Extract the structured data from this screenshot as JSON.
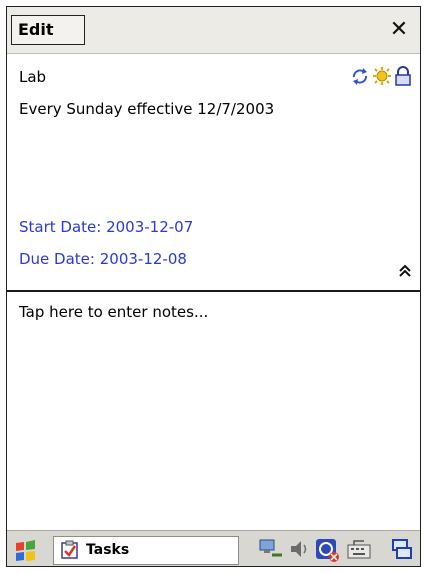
{
  "header": {
    "edit_label": "Edit",
    "close_label": "✕"
  },
  "task": {
    "name": "Lab",
    "recurrence": "Every Sunday effective 12/7/2003",
    "start_date": "Start Date: 2003-12-07",
    "due_date": "Due Date: 2003-12-08"
  },
  "notes": {
    "placeholder": "Tap here to enter notes..."
  },
  "taskbar": {
    "active_task": "Tasks"
  },
  "colors": {
    "link_blue": "#2b38d6",
    "titlebar": "#ecebe6",
    "taskbar": "#d8d7d1"
  },
  "icons": [
    "recurrence-icon",
    "priority-high-icon",
    "private-lock-icon",
    "collapse-icon",
    "start-menu-icon",
    "tasks-icon",
    "connectivity-icon",
    "volume-icon",
    "sync-icon",
    "keyboard-icon",
    "window-icon"
  ]
}
